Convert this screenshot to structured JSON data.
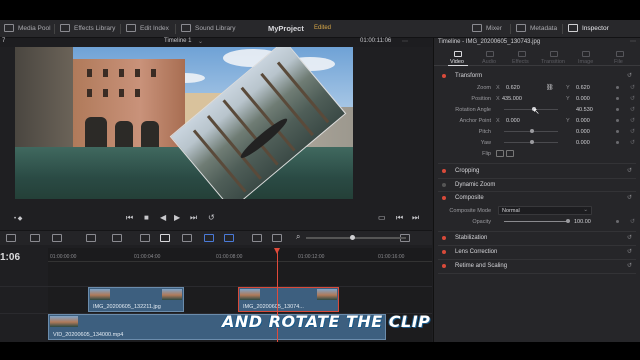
{
  "toolbar": {
    "media_pool": "Media Pool",
    "effects_library": "Effects Library",
    "edit_index": "Edit Index",
    "sound_library": "Sound Library",
    "project_title": "MyProject",
    "project_status": "Edited",
    "mixer": "Mixer",
    "metadata": "Metadata",
    "inspector": "Inspector"
  },
  "viewer": {
    "left_marker": "7",
    "timeline_name": "Timeline 1",
    "timecode": "01:00:11:06",
    "inspector_clip": "Timeline - IMG_20200605_130743.jpg"
  },
  "inspector": {
    "tabs": [
      "Video",
      "Audio",
      "Effects",
      "Transition",
      "Image",
      "File"
    ],
    "transform": {
      "label": "Transform",
      "zoom_label": "Zoom",
      "zoom_x": "0.620",
      "zoom_y": "0.620",
      "position_label": "Position",
      "position_x": "435.000",
      "position_y": "0.000",
      "rotation_label": "Rotation Angle",
      "rotation_value": "40.530",
      "anchor_label": "Anchor Point",
      "anchor_x": "0.000",
      "anchor_y": "0.000",
      "pitch_label": "Pitch",
      "pitch_value": "0.000",
      "yaw_label": "Yaw",
      "yaw_value": "0.000",
      "flip_label": "Flip",
      "axis_x": "X",
      "axis_y": "Y"
    },
    "cropping": "Cropping",
    "dynamic_zoom": "Dynamic Zoom",
    "composite": {
      "label": "Composite",
      "mode_label": "Composite Mode",
      "mode_value": "Normal",
      "opacity_label": "Opacity",
      "opacity_value": "100.00"
    },
    "stabilization": "Stabilization",
    "lens_correction": "Lens Correction",
    "retime": "Retime and Scaling"
  },
  "timeline": {
    "current_time": "1:06",
    "ruler": [
      "01:00:00:00",
      "01:00:04:00",
      "01:00:08:00",
      "01:00:12:00",
      "01:00:16:00"
    ],
    "clips": [
      {
        "name": "IMG_20200605_132211.jpg"
      },
      {
        "name": "IMG_20200605_13074..."
      },
      {
        "name": "VID_20200605_134000.mp4"
      }
    ]
  },
  "caption": "AND ROTATE THE CLIP"
}
